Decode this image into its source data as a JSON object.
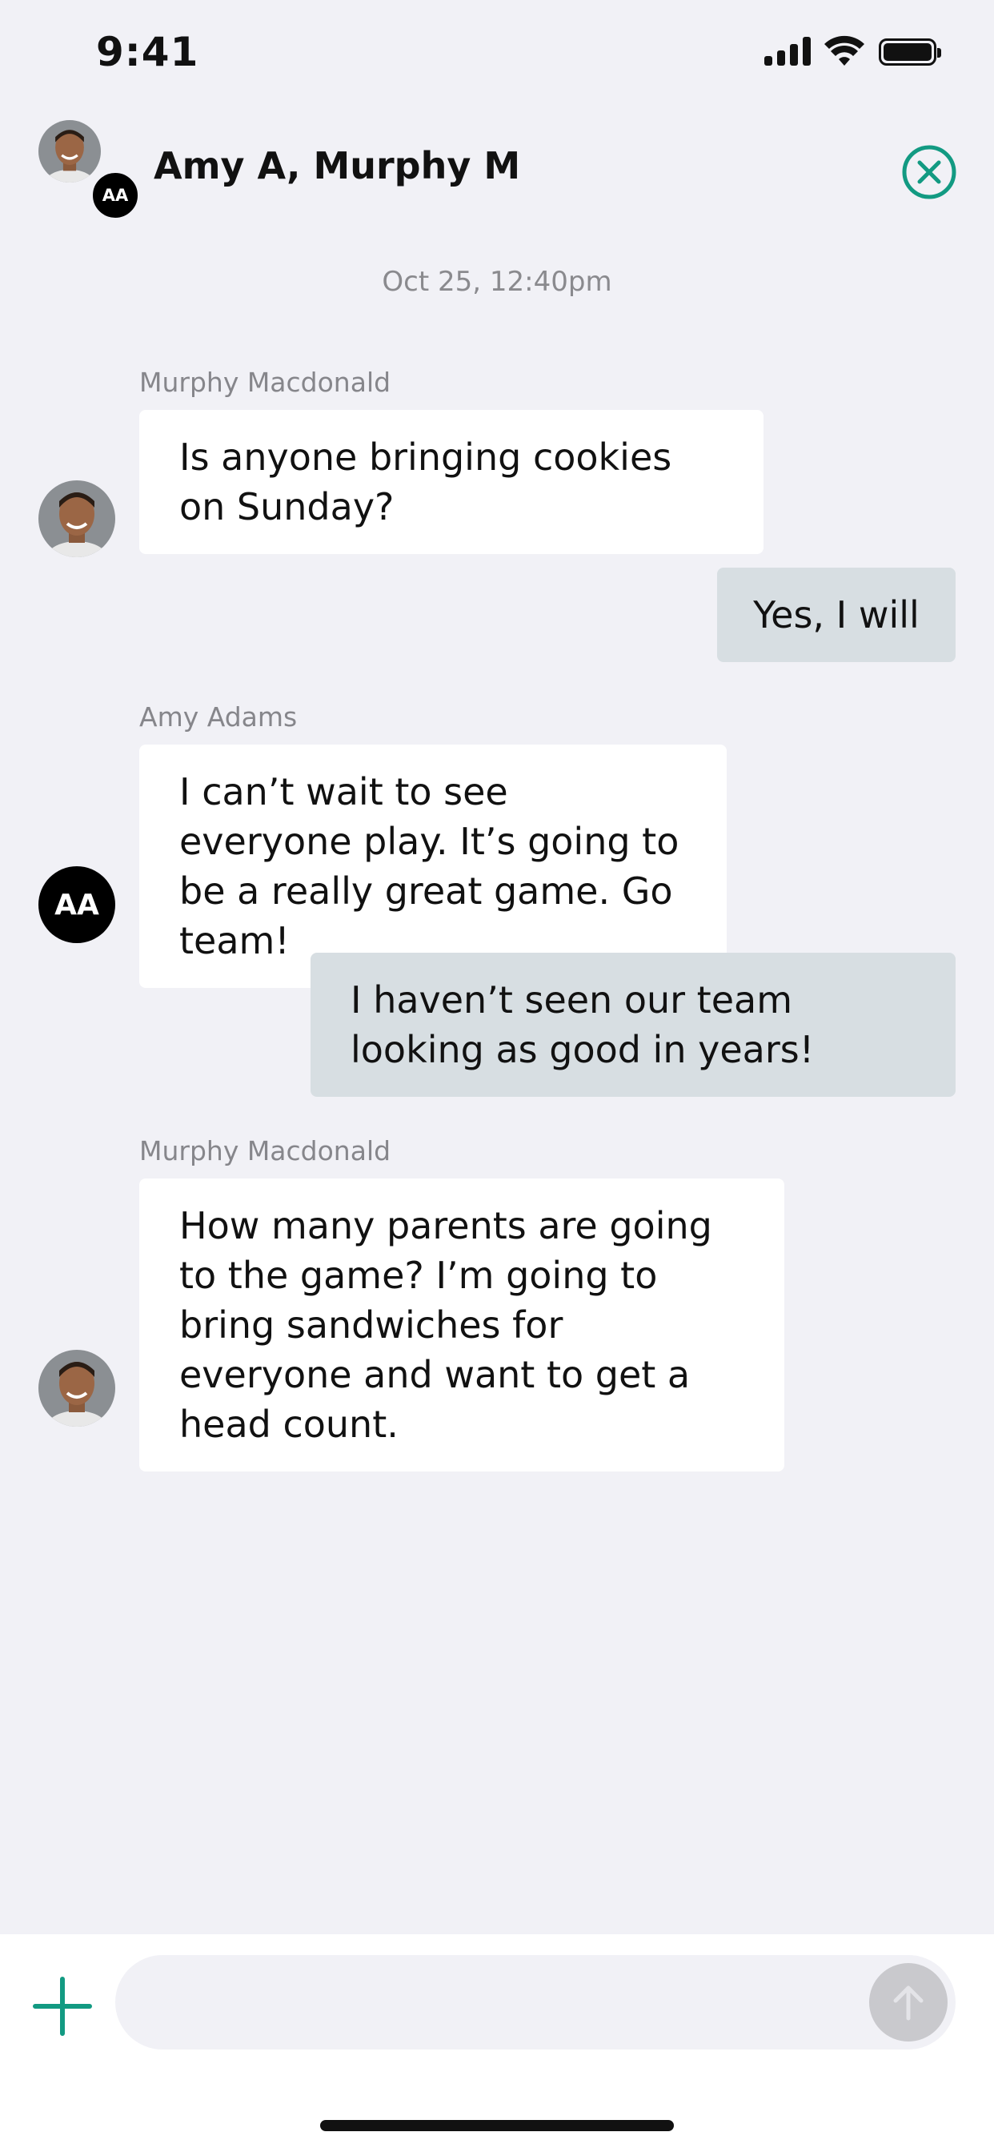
{
  "status_bar": {
    "time": "9:41"
  },
  "header": {
    "avatar_initials": "AA",
    "title": "Amy A, Murphy M"
  },
  "timestamp": "Oct 25, 12:40pm",
  "messages": [
    {
      "sender": "Murphy Macdonald",
      "text": "Is anyone bringing cookies on Sunday?",
      "direction": "incoming"
    },
    {
      "text": "Yes, I will",
      "direction": "outgoing"
    },
    {
      "sender": "Amy Adams",
      "avatar_initials": "AA",
      "text": "I can’t wait to see everyone play. It’s going to be a really great game. Go team!",
      "direction": "incoming"
    },
    {
      "text": "I haven’t seen our team looking as good in years!",
      "direction": "outgoing"
    },
    {
      "sender": "Murphy Macdonald",
      "text": "How many parents are going to the game? I’m going to bring sandwiches for everyone and want to get a head count.",
      "direction": "incoming"
    }
  ],
  "composer": {
    "placeholder": ""
  },
  "colors": {
    "accent": "#129a82",
    "outgoing_bubble": "#d7dee2",
    "background": "#f1f1f6"
  }
}
